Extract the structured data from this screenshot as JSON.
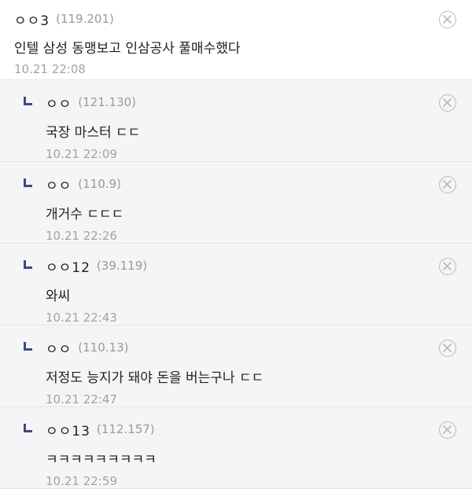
{
  "comments": [
    {
      "nickname": "ㅇㅇ3",
      "ip": "(119.201)",
      "content": "인텔 삼성 동맹보고 인삼공사 풀매수했다",
      "date": "10.21 22:08",
      "is_reply": false
    },
    {
      "nickname": "ㅇㅇ",
      "ip": "(121.130)",
      "content": "국장 마스터 ㄷㄷ",
      "date": "10.21 22:09",
      "is_reply": true
    },
    {
      "nickname": "ㅇㅇ",
      "ip": "(110.9)",
      "content": "개거수 ㄷㄷㄷ",
      "date": "10.21 22:26",
      "is_reply": true
    },
    {
      "nickname": "ㅇㅇ12",
      "ip": "(39.119)",
      "content": "와씨",
      "date": "10.21 22:43",
      "is_reply": true
    },
    {
      "nickname": "ㅇㅇ",
      "ip": "(110.13)",
      "content": "저정도 능지가 돼야 돈을 버는구나 ㄷㄷ",
      "date": "10.21 22:47",
      "is_reply": true
    },
    {
      "nickname": "ㅇㅇ13",
      "ip": "(112.157)",
      "content": "ㅋㅋㅋㅋㅋㅋㅋㅋㅋ",
      "date": "10.21 22:59",
      "is_reply": true
    }
  ],
  "icons": {
    "delete": "close-circle-icon",
    "reply": "reply-arrow-icon"
  },
  "colors": {
    "reply_background": "#f5f5f7",
    "reply_arrow": "#3e4a80",
    "meta_text": "#9a9a9a"
  }
}
